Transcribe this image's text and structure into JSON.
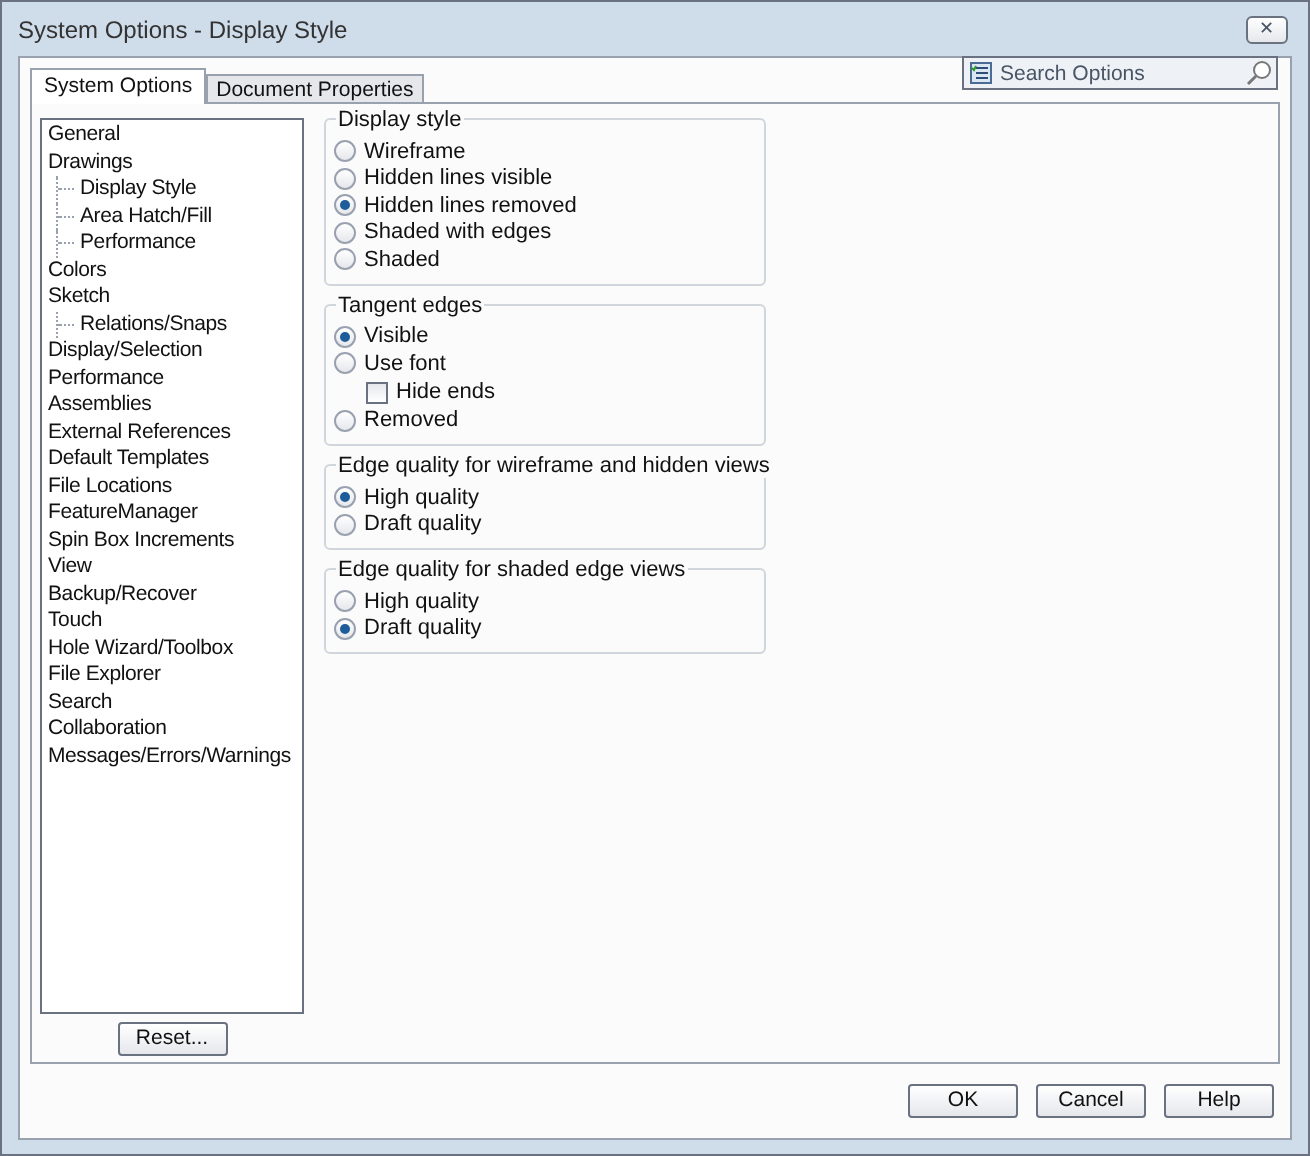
{
  "window": {
    "title": "System Options - Display Style",
    "close": "✕"
  },
  "tabs": [
    {
      "label": "System Options",
      "selected": true
    },
    {
      "label": "Document Properties",
      "selected": false
    }
  ],
  "search": {
    "placeholder": "Search Options"
  },
  "tree": [
    {
      "label": "General"
    },
    {
      "label": "Drawings",
      "children": [
        {
          "label": "Display Style"
        },
        {
          "label": "Area Hatch/Fill"
        },
        {
          "label": "Performance"
        }
      ]
    },
    {
      "label": "Colors"
    },
    {
      "label": "Sketch",
      "children": [
        {
          "label": "Relations/Snaps"
        }
      ]
    },
    {
      "label": "Display/Selection"
    },
    {
      "label": "Performance"
    },
    {
      "label": "Assemblies"
    },
    {
      "label": "External References"
    },
    {
      "label": "Default Templates"
    },
    {
      "label": "File Locations"
    },
    {
      "label": "FeatureManager"
    },
    {
      "label": "Spin Box Increments"
    },
    {
      "label": "View"
    },
    {
      "label": "Backup/Recover"
    },
    {
      "label": "Touch"
    },
    {
      "label": "Hole Wizard/Toolbox"
    },
    {
      "label": "File Explorer"
    },
    {
      "label": "Search"
    },
    {
      "label": "Collaboration"
    },
    {
      "label": "Messages/Errors/Warnings"
    }
  ],
  "reset_button": "Reset...",
  "groups": [
    {
      "title": "Display style",
      "options": [
        {
          "kind": "radio",
          "label": "Wireframe",
          "selected": false
        },
        {
          "kind": "radio",
          "label": "Hidden lines visible",
          "selected": false
        },
        {
          "kind": "radio",
          "label": "Hidden lines removed",
          "selected": true
        },
        {
          "kind": "radio",
          "label": "Shaded with edges",
          "selected": false
        },
        {
          "kind": "radio",
          "label": "Shaded",
          "selected": false
        }
      ]
    },
    {
      "title": "Tangent edges",
      "options": [
        {
          "kind": "radio",
          "label": "Visible",
          "selected": true
        },
        {
          "kind": "radio",
          "label": "Use font",
          "selected": false
        },
        {
          "kind": "checkbox",
          "label": "Hide ends",
          "checked": false
        },
        {
          "kind": "radio",
          "label": "Removed",
          "selected": false
        }
      ]
    },
    {
      "title": "Edge quality for wireframe and hidden views",
      "options": [
        {
          "kind": "radio",
          "label": "High quality",
          "selected": true
        },
        {
          "kind": "radio",
          "label": "Draft quality",
          "selected": false
        }
      ]
    },
    {
      "title": "Edge quality for shaded edge views",
      "options": [
        {
          "kind": "radio",
          "label": "High quality",
          "selected": false
        },
        {
          "kind": "radio",
          "label": "Draft quality",
          "selected": true
        }
      ]
    }
  ],
  "buttons": [
    "OK",
    "Cancel",
    "Help"
  ]
}
